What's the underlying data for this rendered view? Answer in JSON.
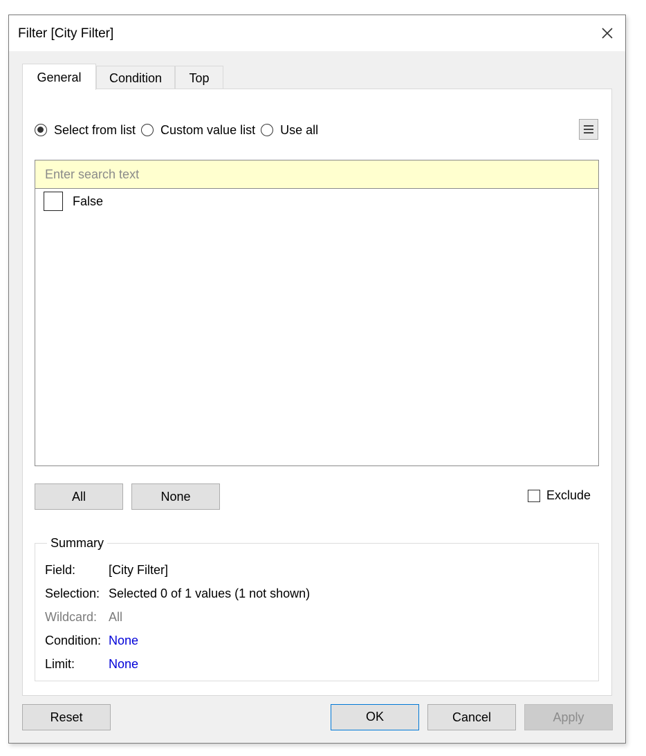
{
  "dialog": {
    "title": "Filter [City Filter]"
  },
  "tabs": [
    {
      "label": "General",
      "active": true
    },
    {
      "label": "Condition",
      "active": false
    },
    {
      "label": "Top",
      "active": false
    }
  ],
  "mode": {
    "options": [
      {
        "label": "Select from list",
        "checked": true
      },
      {
        "label": "Custom value list",
        "checked": false
      },
      {
        "label": "Use all",
        "checked": false
      }
    ]
  },
  "search": {
    "placeholder": "Enter search text",
    "value": ""
  },
  "list": {
    "items": [
      {
        "label": "False",
        "checked": false
      }
    ]
  },
  "buttons": {
    "all": "All",
    "none": "None",
    "reset": "Reset",
    "ok": "OK",
    "cancel": "Cancel",
    "apply": "Apply"
  },
  "exclude": {
    "label": "Exclude",
    "checked": false
  },
  "summary": {
    "legend": "Summary",
    "rows": [
      {
        "key": "Field:",
        "value": "[City Filter]"
      },
      {
        "key": "Selection:",
        "value": "Selected 0 of 1 values (1 not shown)"
      },
      {
        "key": "Wildcard:",
        "value": "All"
      },
      {
        "key": "Condition:",
        "value": "None"
      },
      {
        "key": "Limit:",
        "value": "None"
      }
    ]
  },
  "colors": {
    "accent": "#0078d7",
    "link": "#0000d8",
    "search_bg": "#ffffcf"
  }
}
